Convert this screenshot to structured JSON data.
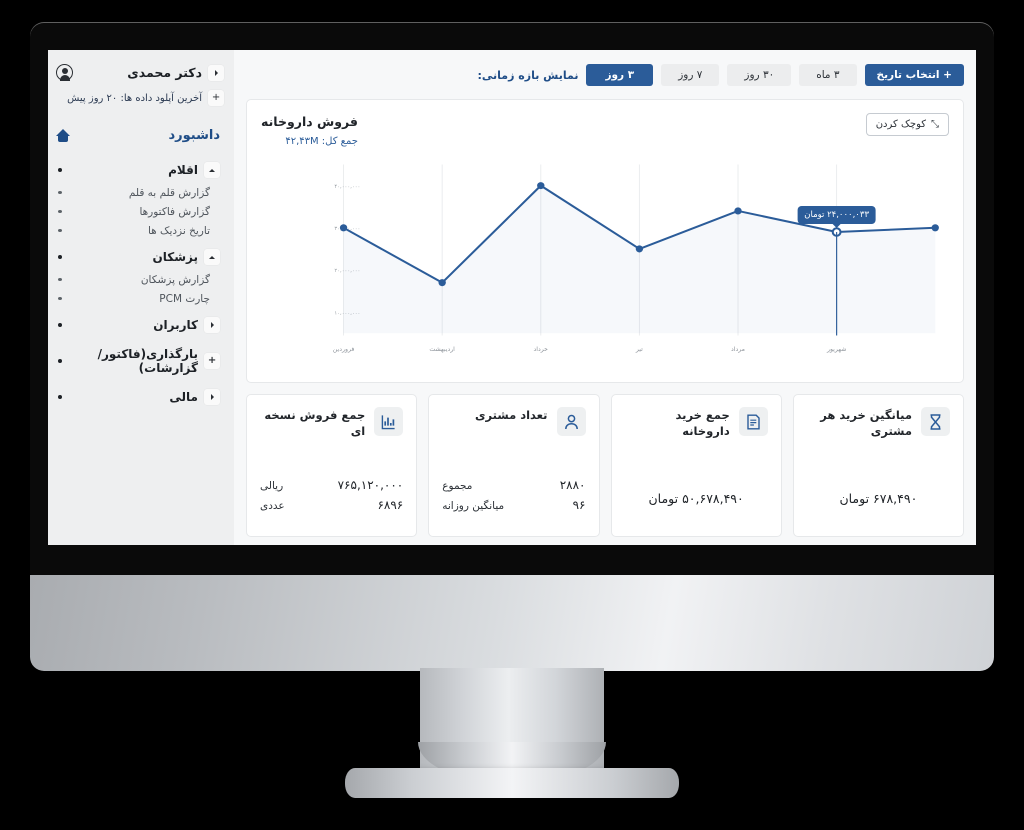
{
  "sidebar": {
    "user": {
      "name": "دکتر محمدی",
      "icon": "user-avatar-icon",
      "toggle": "chevron-left-icon"
    },
    "upload_status": {
      "text": "آخرین آپلود داده ها: ۲۰ روز پیش",
      "toggle": "plus-icon"
    },
    "dashboard": {
      "label": "داشبورد",
      "icon": "home-icon"
    },
    "groups": [
      {
        "label": "اقلام",
        "toggle": "chevron-up-icon",
        "items": [
          {
            "label": "گزارش قلم به قلم"
          },
          {
            "label": "گزارش فاکتورها"
          },
          {
            "label": "تاریخ نزدیک ها"
          }
        ]
      },
      {
        "label": "پزشکان",
        "toggle": "chevron-up-icon",
        "items": [
          {
            "label": "گزارش پزشکان"
          },
          {
            "label": "چارت PCM"
          }
        ]
      },
      {
        "label": "کاربران",
        "toggle": "chevron-left-icon",
        "items": []
      },
      {
        "label": "بارگذاری(فاکتور/گزارشات)",
        "toggle": "plus-icon",
        "items": []
      },
      {
        "label": "مالی",
        "toggle": "chevron-left-icon",
        "items": []
      }
    ]
  },
  "toolbar": {
    "label": "نمایش بازه زمانی:",
    "ranges": [
      {
        "label": "۳ روز",
        "active": true
      },
      {
        "label": "۷ روز",
        "active": false
      },
      {
        "label": "۳۰ روز",
        "active": false
      },
      {
        "label": "۳ ماه",
        "active": false
      }
    ],
    "date_picker_label": "+ انتخاب تاریخ"
  },
  "chart_card": {
    "title": "فروش داروخانه",
    "subtitle": "جمع کل: ۴۲,۴۳M",
    "shrink_label": "کوچک کردن",
    "shrink_icon": "collapse-arrows-icon",
    "tooltip": "۲۴,۰۰۰,۰۳۳ تومان"
  },
  "chart_data": {
    "type": "line",
    "title": "فروش داروخانه",
    "xlabel": "",
    "ylabel": "",
    "categories": [
      "فروردین",
      "اردیبهشت",
      "خرداد",
      "تیر",
      "مرداد",
      "شهریور"
    ],
    "x_extra_points": 7,
    "values": [
      30000000,
      17000000,
      40000000,
      25000000,
      34000000,
      29000000,
      30000000
    ],
    "ytick_labels": [
      "۴۰,۰۰۰,۰۰۰",
      "۳۰,۰۰۰,۰۰۰",
      "۲۰,۰۰۰,۰۰۰",
      "۱۰,۰۰۰,۰۰۰"
    ],
    "ytick_values": [
      40000000,
      30000000,
      20000000,
      10000000
    ],
    "ylim": [
      5000000,
      45000000
    ],
    "grid": "vertical",
    "legend": "none",
    "line_color": "#2b5c99",
    "marker_color": "#2b5c99",
    "highlight_index": 5,
    "highlight_label": "۲۴,۰۰۰,۰۳۳ تومان"
  },
  "stats": [
    {
      "title": "جمع فروش نسخه ای",
      "icon": "bar-chart-icon",
      "lines": [
        {
          "key": "ریالی",
          "value": "۷۶۵,۱۲۰,۰۰۰"
        },
        {
          "key": "عددی",
          "value": "۶۸۹۶"
        }
      ],
      "single": null
    },
    {
      "title": "تعداد مشتری",
      "icon": "person-icon",
      "lines": [
        {
          "key": "مجموع",
          "value": "۲۸۸۰"
        },
        {
          "key": "میانگین روزانه",
          "value": "۹۶"
        }
      ],
      "single": null
    },
    {
      "title": "جمع خرید داروخانه",
      "icon": "document-icon",
      "lines": [],
      "single": "۵۰,۶۷۸,۴۹۰ تومان"
    },
    {
      "title": "میانگین خرید هر مشتری",
      "icon": "hourglass-icon",
      "lines": [],
      "single": "۶۷۸,۴۹۰ تومان"
    }
  ],
  "colors": {
    "accent": "#2b5c99",
    "sidebar_bg": "#eeeff0",
    "page_bg": "#f7f8f9"
  }
}
